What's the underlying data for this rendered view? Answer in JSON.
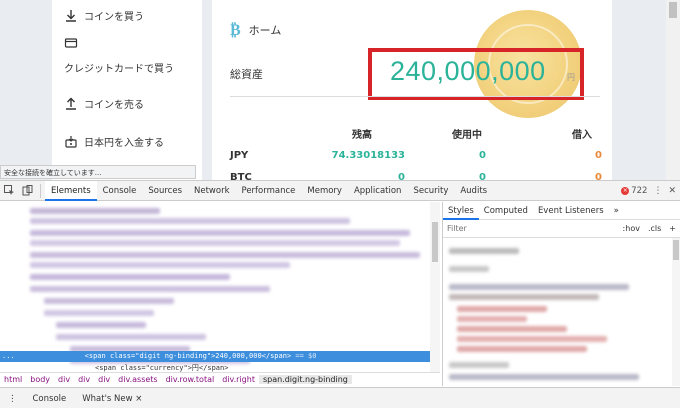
{
  "sidebar": {
    "items": [
      {
        "label": "コインを買う",
        "icon": "download-icon"
      },
      {
        "label": "",
        "icon": "credit-card-icon"
      },
      {
        "label": "クレジットカードで買う",
        "icon": ""
      },
      {
        "label": "コインを売る",
        "icon": "upload-icon"
      },
      {
        "label": "日本円を入金する",
        "icon": "bank-deposit-icon"
      }
    ]
  },
  "main": {
    "home_label": "ホーム",
    "btc_symbol": "₿",
    "total_assets_label": "総資産",
    "total_assets_value": "240,000,000",
    "total_assets_currency": "円",
    "table": {
      "headers": [
        "残高",
        "使用中",
        "借入"
      ],
      "rows": [
        {
          "asset": "JPY",
          "balance": "74.33018133",
          "in_use": "0",
          "borrowed": "0"
        },
        {
          "asset": "BTC",
          "balance": "0",
          "in_use": "0",
          "borrowed": "0"
        }
      ]
    },
    "accent_color": "#2bb39a",
    "highlight_color": "#d62428"
  },
  "status_tip": "安全な接続を確立しています...",
  "devtools": {
    "tabs": [
      "Elements",
      "Console",
      "Sources",
      "Network",
      "Performance",
      "Memory",
      "Application",
      "Security",
      "Audits"
    ],
    "active_tab": "Elements",
    "error_count": "722",
    "selected_line": {
      "prefix": "...",
      "code": "<span class=\"digit ng-binding\">240,000,000</span>",
      "suffix": "== $0"
    },
    "next_line": "<span class=\"currency\">円</span>",
    "breadcrumb": [
      "html",
      "body",
      "div",
      "div",
      "div",
      "div.assets",
      "div.row.total",
      "div.right",
      "span.digit.ng-binding"
    ],
    "styles_tabs": [
      "Styles",
      "Computed",
      "Event Listeners",
      "»"
    ],
    "filter_placeholder": "Filter",
    "filter_hov": ":hov",
    "filter_cls": ".cls",
    "filter_add": "+",
    "drawer_tabs": [
      "Console",
      "What's New ×"
    ]
  }
}
